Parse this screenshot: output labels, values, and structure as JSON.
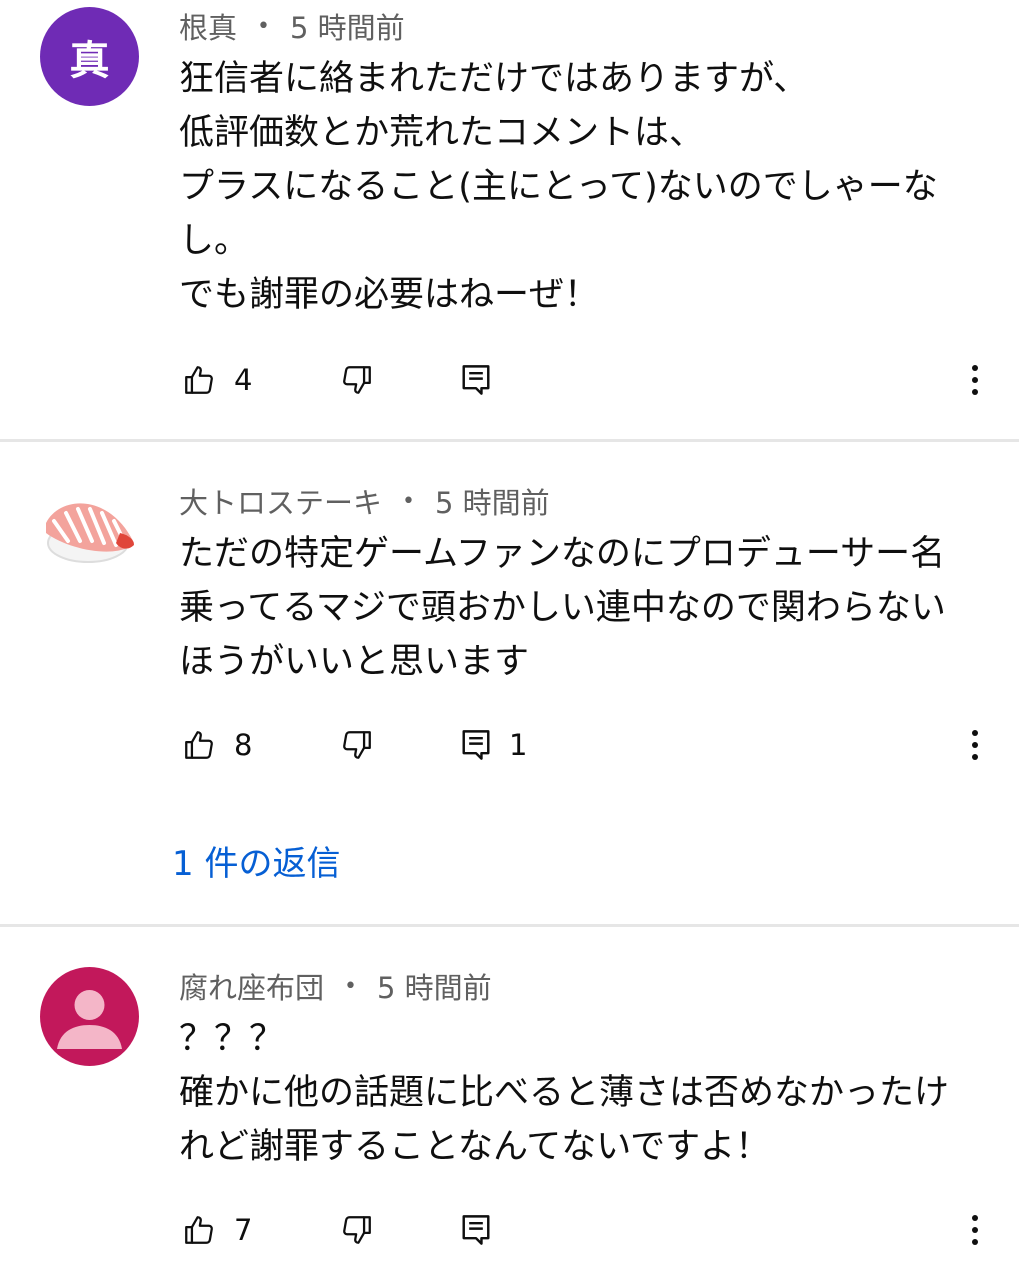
{
  "comments": [
    {
      "author": "根真",
      "avatar_text": "真",
      "dot": "•",
      "time": "5 時間前",
      "lines": [
        "狂信者に絡まれただけではありますが、",
        "低評価数とか荒れたコメントは、",
        "プラスになること(主にとって)ないのでしゃーな",
        "し。",
        "でも謝罪の必要はねーぜ！"
      ],
      "likes": "4",
      "reply_count": ""
    },
    {
      "author": "大トロステーキ",
      "avatar_icon": "sushi-avatar",
      "dot": "•",
      "time": "5 時間前",
      "lines": [
        "ただの特定ゲームファンなのにプロデューサー名",
        "乗ってるマジで頭おかしい連中なので関わらない",
        "ほうがいいと思います"
      ],
      "likes": "8",
      "reply_count": "1",
      "replies_link": "1 件の返信"
    },
    {
      "author": "腐れ座布団",
      "avatar_icon": "default-person-avatar",
      "dot": "•",
      "time": "5 時間前",
      "lines": [
        "？？？",
        "確かに他の話題に比べると薄さは否めなかったけ",
        "れど謝罪することなんてないですよ！"
      ],
      "likes": "7",
      "reply_count": ""
    }
  ],
  "colors": {
    "avatar_purple": "#6f2bb5",
    "avatar_pink": "#c2185b",
    "link_blue": "#065fd4",
    "meta_gray": "#606060"
  }
}
